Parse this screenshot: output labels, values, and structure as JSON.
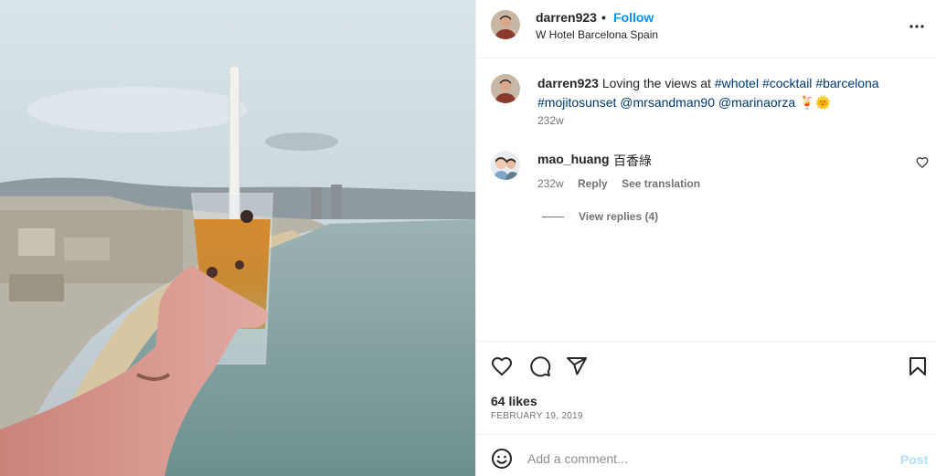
{
  "photo": {
    "alt_subject": "hand holding cocktail over Barcelona coastline"
  },
  "header": {
    "username": "darren923",
    "separator": "•",
    "follow_label": "Follow",
    "location": "W Hotel Barcelona Spain",
    "more_icon": "more-horizontal-icon"
  },
  "caption": {
    "username": "darren923",
    "text_before": "Loving the views at",
    "tags": [
      "#whotel",
      "#cocktail",
      "#barcelona",
      "#mojitosunset",
      "@mrsandman90",
      "@marinaorza"
    ],
    "emojis": "🍹🌞",
    "time": "232w"
  },
  "comment": {
    "username": "mao_huang",
    "text": "百香綠",
    "time": "232w",
    "reply_label": "Reply",
    "translate_label": "See translation",
    "view_replies": "View replies (4)"
  },
  "actions": {
    "like_icon": "heart-icon",
    "comment_icon": "comment-icon",
    "share_icon": "paper-plane-icon",
    "save_icon": "bookmark-icon"
  },
  "likes": "64 likes",
  "date": "FEBRUARY 19, 2019",
  "add_comment": {
    "placeholder": "Add a comment...",
    "post_label": "Post"
  },
  "colors": {
    "link_blue": "#0095f6",
    "hashtag": "#00376b",
    "muted": "#737373",
    "border": "#efefef"
  }
}
